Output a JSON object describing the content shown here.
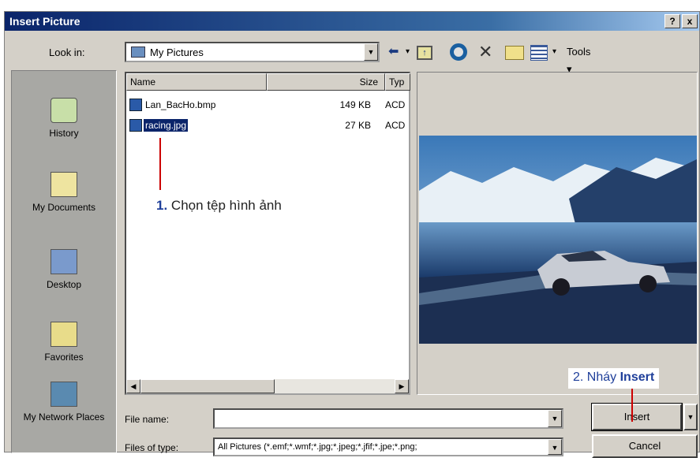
{
  "dialog": {
    "title": "Insert Picture",
    "help_button": "?",
    "close_button": "x"
  },
  "lookin": {
    "label": "Look in:",
    "value": "My Pictures"
  },
  "toolbar": {
    "tools_label": "Tools"
  },
  "places": [
    {
      "label": "History"
    },
    {
      "label": "My Documents"
    },
    {
      "label": "Desktop"
    },
    {
      "label": "Favorites"
    },
    {
      "label": "My Network Places"
    }
  ],
  "filelist": {
    "columns": [
      "Name",
      "Size",
      "Typ"
    ],
    "rows": [
      {
        "name": "Lan_BacHo.bmp",
        "size": "149 KB",
        "type": "ACD"
      },
      {
        "name": "racing.jpg",
        "size": "27 KB",
        "type": "ACD"
      }
    ]
  },
  "annotations": {
    "step1_number": "1.",
    "step1_text": "Chọn tệp hình ảnh",
    "step2_prefix": "2. Nháy",
    "step2_bold": "Insert"
  },
  "filename": {
    "label": "File name:",
    "value": ""
  },
  "filetype": {
    "label": "Files of type:",
    "value": "All Pictures (*.emf;*.wmf;*.jpg;*.jpeg;*.jfif;*.jpe;*.png;"
  },
  "buttons": {
    "insert": "Insert",
    "cancel": "Cancel"
  }
}
